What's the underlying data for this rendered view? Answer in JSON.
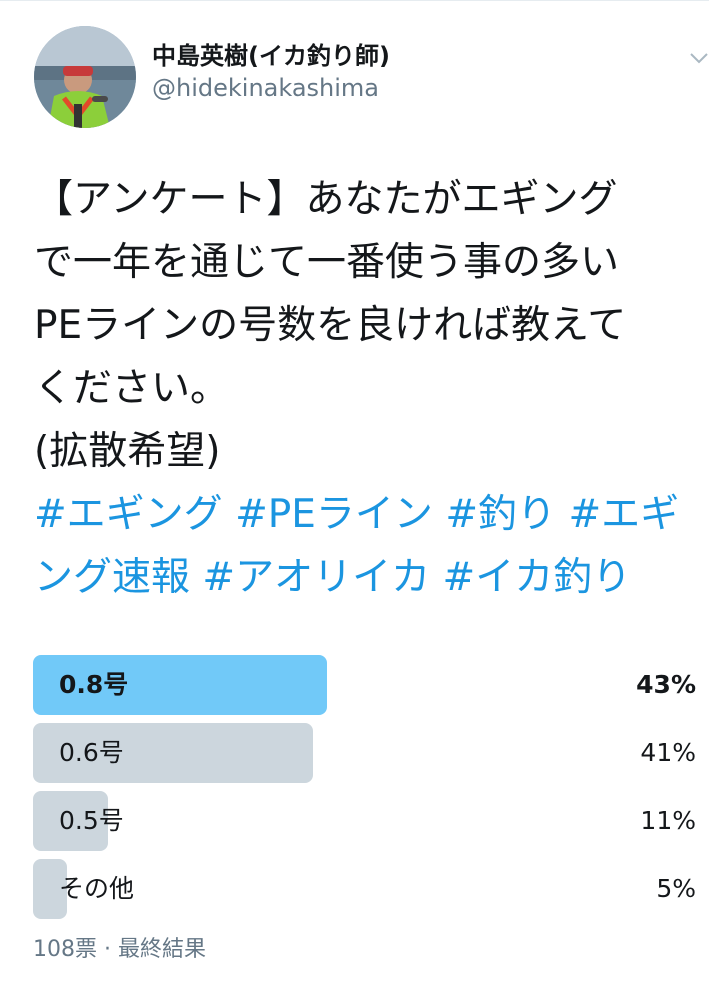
{
  "user": {
    "display_name": "中島英樹(イカ釣り師)",
    "handle": "@hidekinakashima"
  },
  "tweet": {
    "lines": [
      "【アンケート】あなたがエギング",
      "で一年を通じて一番使う事の多い",
      "PEラインの号数を良ければ教えて",
      "ください。",
      "(拡散希望)"
    ],
    "hashtag_lines": [
      [
        "#エギング",
        "#PEライン",
        "#釣り",
        "#エギ"
      ],
      [
        "ング速報",
        "#アオリイカ",
        "#イカ釣り"
      ]
    ]
  },
  "poll": {
    "options": [
      {
        "label": "0.8号",
        "percent": 43,
        "percent_text": "43%",
        "winner": true
      },
      {
        "label": "0.6号",
        "percent": 41,
        "percent_text": "41%",
        "winner": false
      },
      {
        "label": "0.5号",
        "percent": 11,
        "percent_text": "11%",
        "winner": false
      },
      {
        "label": "その他",
        "percent": 5,
        "percent_text": "5%",
        "winner": false
      }
    ],
    "footer": "108票 · 最終結果"
  },
  "colors": {
    "winner_bar": "#71c9f8",
    "other_bar": "#ccd6dd",
    "hashtag": "#1b95e0",
    "secondary_text": "#657786"
  }
}
